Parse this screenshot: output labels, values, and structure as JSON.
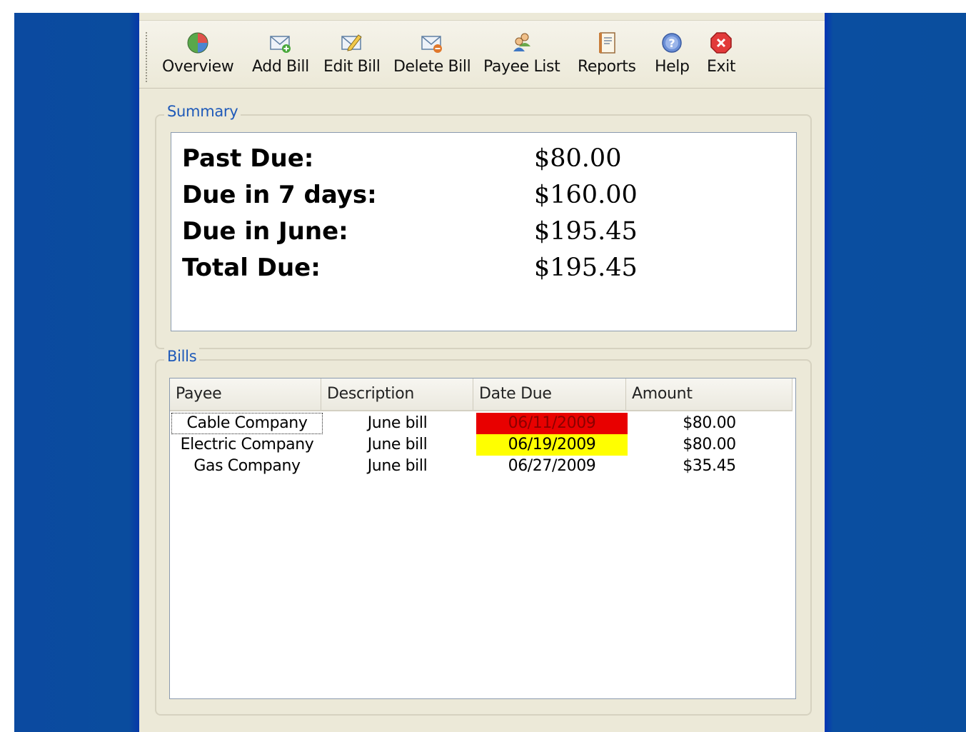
{
  "toolbar": {
    "buttons": [
      {
        "label": "Overview",
        "icon": "pie-chart-icon"
      },
      {
        "label": "Add Bill",
        "icon": "envelope-add-icon"
      },
      {
        "label": "Edit Bill",
        "icon": "envelope-edit-icon"
      },
      {
        "label": "Delete Bill",
        "icon": "envelope-delete-icon"
      },
      {
        "label": "Payee List",
        "icon": "people-icon"
      },
      {
        "label": "Reports",
        "icon": "notebook-icon"
      },
      {
        "label": "Help",
        "icon": "help-icon"
      },
      {
        "label": "Exit",
        "icon": "exit-icon"
      }
    ]
  },
  "summary": {
    "title": "Summary",
    "rows": [
      {
        "label": "Past Due:",
        "value": "$80.00"
      },
      {
        "label": "Due in 7 days:",
        "value": "$160.00"
      },
      {
        "label": "Due in June:",
        "value": "$195.45"
      },
      {
        "label": "Total Due:",
        "value": "$195.45"
      }
    ]
  },
  "bills": {
    "title": "Bills",
    "columns": [
      "Payee",
      "Description",
      "Date Due",
      "Amount"
    ],
    "rows": [
      {
        "payee": "Cable Company",
        "description": "June bill",
        "date_due": "06/11/2009",
        "amount": "$80.00",
        "status": "past-due"
      },
      {
        "payee": "Electric Company",
        "description": "June bill",
        "date_due": "06/19/2009",
        "amount": "$80.00",
        "status": "due-soon"
      },
      {
        "payee": "Gas Company",
        "description": "June bill",
        "date_due": "06/27/2009",
        "amount": "$35.45",
        "status": "normal"
      }
    ]
  },
  "colors": {
    "desktop": "#0a4c9e",
    "window": "#ece9d8",
    "group_title": "#1f5ab9",
    "past_due_bg": "#e80000",
    "past_due_text": "#8b0000",
    "due_soon_bg": "#ffff00"
  }
}
